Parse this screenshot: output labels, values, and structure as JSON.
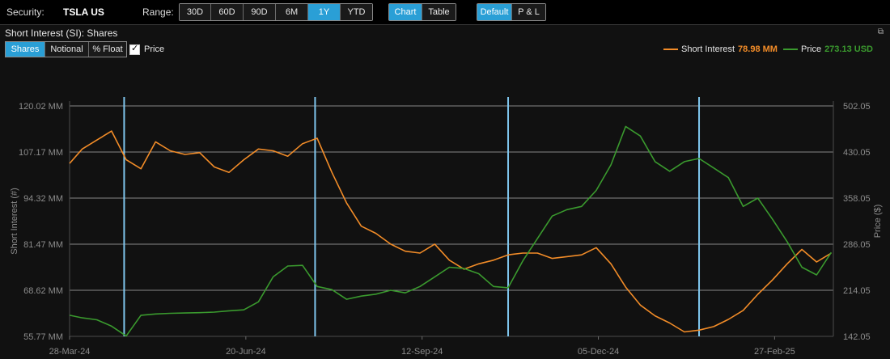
{
  "toolbar": {
    "security_label": "Security:",
    "security": "TSLA US",
    "range_label": "Range:",
    "ranges": [
      "30D",
      "60D",
      "90D",
      "6M",
      "1Y",
      "YTD"
    ],
    "range_active": "1Y",
    "views": [
      "Chart",
      "Table"
    ],
    "view_active": "Chart",
    "modes": [
      "Default",
      "P & L"
    ],
    "mode_active": "Default"
  },
  "panel": {
    "title": "Short Interest (SI): Shares",
    "tabs": [
      "Shares",
      "Notional",
      "% Float"
    ],
    "tab_active": "Shares",
    "price_checkbox_label": "Price",
    "price_checked": true,
    "restore_icon": "restore-window-icon"
  },
  "colors": {
    "short_interest": "#f28c28",
    "price": "#3a9a2e",
    "vertical_markers": "#7fc6ee",
    "grid": "#b0b0b0",
    "axis_text": "#8c8c8c"
  },
  "chart_data": {
    "type": "line",
    "title": "",
    "xlabel": "",
    "ylabel": "Short Interest (#)",
    "y2label": "Price ($)",
    "x_tick_labels": [
      "28-Mar-24",
      "20-Jun-24",
      "12-Sep-24",
      "05-Dec-24",
      "27-Feb-25"
    ],
    "y_tick_labels": [
      "120.02 MM",
      "107.17 MM",
      "94.32 MM",
      "81.47 MM",
      "68.62 MM",
      "55.77 MM"
    ],
    "y2_tick_labels": [
      "502.05",
      "430.05",
      "358.05",
      "286.05",
      "214.05",
      "142.05"
    ],
    "ylim": [
      55.77,
      120.02
    ],
    "y2lim": [
      142.05,
      502.05
    ],
    "grid": true,
    "legend_position": "top-right",
    "vertical_markers": [
      "2024-04-23",
      "2024-07-23",
      "2024-10-23",
      "2025-01-22"
    ],
    "series": [
      {
        "name": "Short Interest",
        "axis": "left",
        "last_value_label": "78.98 MM",
        "x": [
          "2024-03-28",
          "2024-04-03",
          "2024-04-10",
          "2024-04-17",
          "2024-04-24",
          "2024-05-01",
          "2024-05-08",
          "2024-05-15",
          "2024-05-22",
          "2024-05-29",
          "2024-06-05",
          "2024-06-12",
          "2024-06-19",
          "2024-06-26",
          "2024-07-03",
          "2024-07-10",
          "2024-07-17",
          "2024-07-24",
          "2024-07-31",
          "2024-08-07",
          "2024-08-14",
          "2024-08-21",
          "2024-08-28",
          "2024-09-04",
          "2024-09-11",
          "2024-09-18",
          "2024-09-25",
          "2024-10-02",
          "2024-10-09",
          "2024-10-16",
          "2024-10-23",
          "2024-10-30",
          "2024-11-06",
          "2024-11-13",
          "2024-11-20",
          "2024-11-27",
          "2024-12-04",
          "2024-12-11",
          "2024-12-18",
          "2024-12-25",
          "2025-01-01",
          "2025-01-08",
          "2025-01-15",
          "2025-01-22",
          "2025-01-29",
          "2025-02-05",
          "2025-02-12",
          "2025-02-19",
          "2025-02-26",
          "2025-03-05",
          "2025-03-12",
          "2025-03-19",
          "2025-03-26"
        ],
        "values": [
          104.0,
          108.0,
          110.5,
          113.0,
          105.0,
          102.5,
          110.0,
          107.5,
          106.5,
          107.0,
          103.0,
          101.5,
          105.0,
          108.0,
          107.5,
          106.0,
          109.5,
          111.0,
          101.5,
          93.0,
          86.5,
          84.5,
          81.5,
          79.5,
          79.0,
          81.5,
          77.0,
          74.5,
          76.0,
          77.0,
          78.5,
          79.0,
          79.0,
          77.5,
          78.0,
          78.5,
          80.5,
          76.0,
          69.5,
          64.5,
          61.5,
          59.5,
          57.0,
          57.5,
          58.5,
          60.5,
          63.0,
          67.5,
          71.5,
          76.0,
          80.0,
          76.5,
          78.98
        ]
      },
      {
        "name": "Price",
        "axis": "right",
        "last_value_label": "273.13 USD",
        "x": [
          "2024-03-28",
          "2024-04-03",
          "2024-04-10",
          "2024-04-17",
          "2024-04-24",
          "2024-05-01",
          "2024-05-08",
          "2024-05-15",
          "2024-05-22",
          "2024-05-29",
          "2024-06-05",
          "2024-06-12",
          "2024-06-19",
          "2024-06-26",
          "2024-07-03",
          "2024-07-10",
          "2024-07-17",
          "2024-07-24",
          "2024-07-31",
          "2024-08-07",
          "2024-08-14",
          "2024-08-21",
          "2024-08-28",
          "2024-09-04",
          "2024-09-11",
          "2024-09-18",
          "2024-09-25",
          "2024-10-02",
          "2024-10-09",
          "2024-10-16",
          "2024-10-23",
          "2024-10-30",
          "2024-11-06",
          "2024-11-13",
          "2024-11-20",
          "2024-11-27",
          "2024-12-04",
          "2024-12-11",
          "2024-12-18",
          "2024-12-25",
          "2025-01-01",
          "2025-01-08",
          "2025-01-15",
          "2025-01-22",
          "2025-01-29",
          "2025-02-05",
          "2025-02-12",
          "2025-02-19",
          "2025-02-26",
          "2025-03-05",
          "2025-03-12",
          "2025-03-19",
          "2025-03-26"
        ],
        "values": [
          175.0,
          171.0,
          168.0,
          158.0,
          142.5,
          175.0,
          177.0,
          178.0,
          178.5,
          179.0,
          180.0,
          182.0,
          183.5,
          196.0,
          235.0,
          252.0,
          253.0,
          220.0,
          215.0,
          200.0,
          205.0,
          208.0,
          214.0,
          210.0,
          220.0,
          235.0,
          250.0,
          248.0,
          240.0,
          220.0,
          218.0,
          260.0,
          295.0,
          330.0,
          340.0,
          345.0,
          370.0,
          410.0,
          470.0,
          455.0,
          415.0,
          400.0,
          415.0,
          420.0,
          405.0,
          390.0,
          345.0,
          358.0,
          325.0,
          290.0,
          250.0,
          238.0,
          273.13
        ]
      }
    ]
  }
}
